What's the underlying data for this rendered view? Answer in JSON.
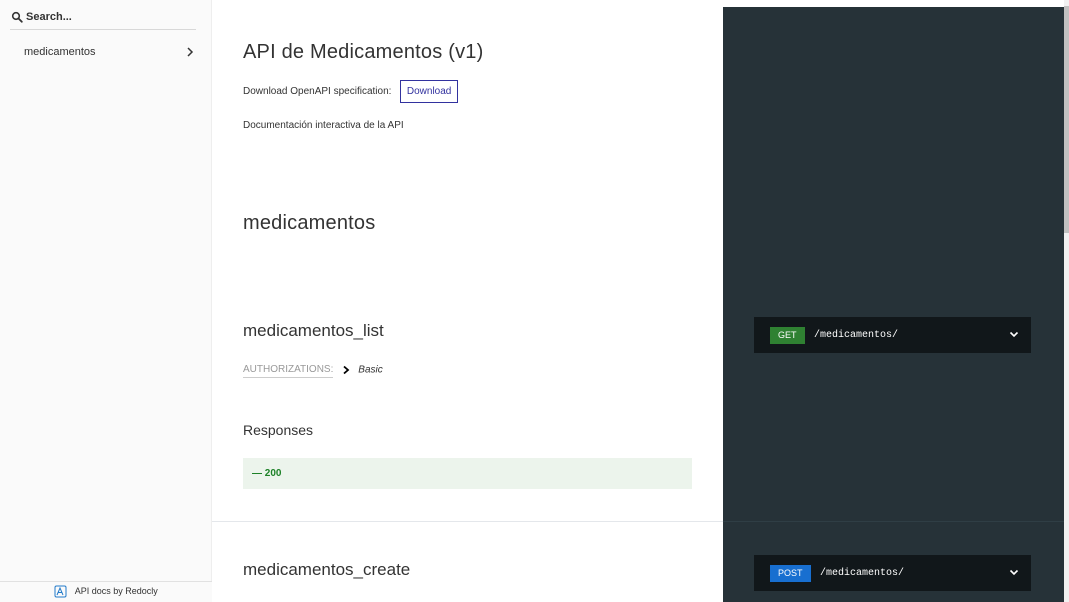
{
  "sidebar": {
    "search_placeholder": "Search...",
    "items": [
      {
        "label": "medicamentos"
      }
    ],
    "powered_by": "API docs by Redocly"
  },
  "api": {
    "title": "API de Medicamentos (v1)",
    "download_text": "Download OpenAPI specification:",
    "download_button": "Download",
    "description": "Documentación interactiva de la API"
  },
  "tag": {
    "title": "medicamentos"
  },
  "operations": [
    {
      "title": "medicamentos_list",
      "auth_label": "AUTHORIZATIONS:",
      "auth_value": "Basic",
      "responses_title": "Responses",
      "response_code": "— 200",
      "method": "GET",
      "path": "/medicamentos/"
    },
    {
      "title": "medicamentos_create",
      "method": "POST",
      "path": "/medicamentos/"
    }
  ],
  "colors": {
    "get": "#2f8132",
    "post": "#186fd0",
    "right_panel": "#263238",
    "endpoint_bg": "#11171a",
    "success": "#1d8127",
    "accent": "#32329f"
  },
  "icons": {
    "search": "search-icon",
    "sidebar_chevron": "chevron-right-icon",
    "auth_arrow": "chevron-right-icon",
    "endpoint_toggle": "chevron-down-icon",
    "redocly": "redocly-logo-icon"
  }
}
